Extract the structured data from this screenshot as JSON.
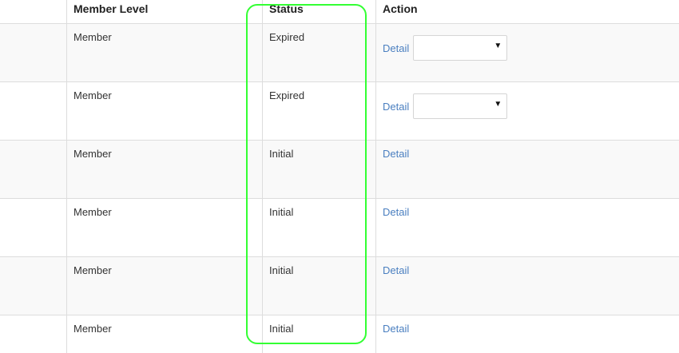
{
  "header": {
    "member_level": "Member Level",
    "status": "Status",
    "action": "Action"
  },
  "rows": [
    {
      "level": "Member",
      "status": "Expired",
      "action": "Detail",
      "has_select": true
    },
    {
      "level": "Member",
      "status": "Expired",
      "action": "Detail",
      "has_select": true
    },
    {
      "level": "Member",
      "status": "Initial",
      "action": "Detail",
      "has_select": false
    },
    {
      "level": "Member",
      "status": "Initial",
      "action": "Detail",
      "has_select": false
    },
    {
      "level": "Member",
      "status": "Initial",
      "action": "Detail",
      "has_select": false
    },
    {
      "level": "Member",
      "status": "Initial",
      "action": "Detail",
      "has_select": false
    }
  ],
  "icons": {
    "select_caret": "caret-down-icon"
  },
  "colors": {
    "link": "#4a7fc0",
    "highlight": "#33ff33",
    "row_alt": "#f9f9f9",
    "border": "#dddddd"
  }
}
